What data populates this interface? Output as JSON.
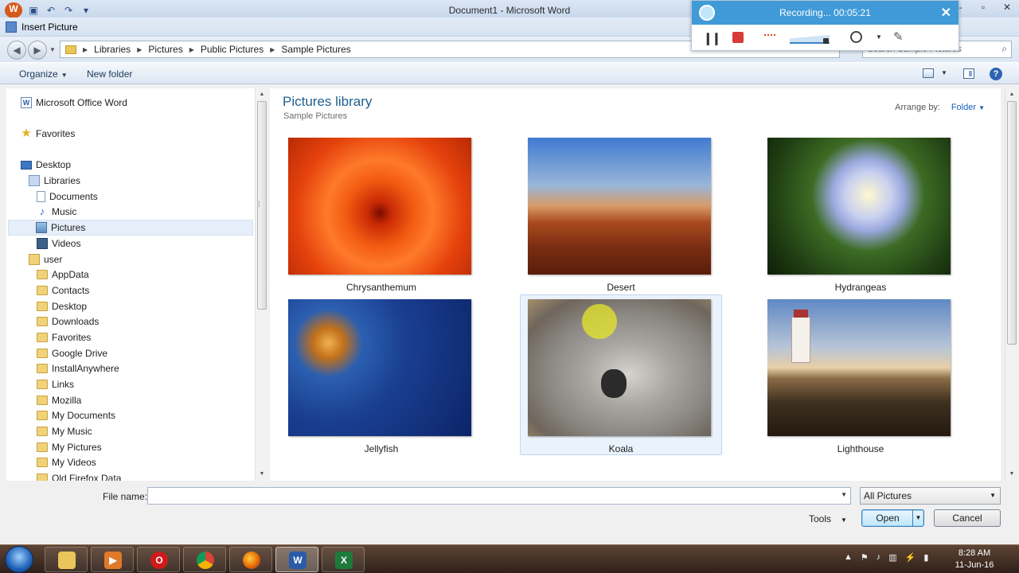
{
  "word_window": {
    "title": "Document1  -  Microsoft Word"
  },
  "dialog": {
    "title": "Insert Picture"
  },
  "address_bar": {
    "crumbs": [
      "Libraries",
      "Pictures",
      "Public Pictures",
      "Sample Pictures"
    ],
    "search_placeholder": "Search Sample Pictures"
  },
  "toolbar": {
    "organize_label": "Organize",
    "new_folder_label": "New folder"
  },
  "nav_pane": {
    "items": [
      {
        "label": "Microsoft Office Word",
        "icon": "word-icon"
      },
      {
        "label": "Favorites",
        "icon": "star-icon"
      },
      {
        "label": "Desktop",
        "icon": "desktop-icon"
      },
      {
        "label": "Libraries",
        "icon": "library-icon"
      },
      {
        "label": "Documents",
        "icon": "documents-icon"
      },
      {
        "label": "Music",
        "icon": "music-icon"
      },
      {
        "label": "Pictures",
        "icon": "pictures-icon",
        "selected": true
      },
      {
        "label": "Videos",
        "icon": "videos-icon"
      },
      {
        "label": "user",
        "icon": "user-folder-icon"
      },
      {
        "label": "AppData",
        "icon": "folder-icon"
      },
      {
        "label": "Contacts",
        "icon": "folder-icon"
      },
      {
        "label": "Desktop",
        "icon": "folder-icon"
      },
      {
        "label": "Downloads",
        "icon": "folder-icon"
      },
      {
        "label": "Favorites",
        "icon": "folder-icon"
      },
      {
        "label": "Google Drive",
        "icon": "folder-icon"
      },
      {
        "label": "InstallAnywhere",
        "icon": "folder-icon"
      },
      {
        "label": "Links",
        "icon": "folder-icon"
      },
      {
        "label": "Mozilla",
        "icon": "folder-icon"
      },
      {
        "label": "My Documents",
        "icon": "folder-icon"
      },
      {
        "label": "My Music",
        "icon": "folder-icon"
      },
      {
        "label": "My Pictures",
        "icon": "folder-icon"
      },
      {
        "label": "My Videos",
        "icon": "folder-icon"
      },
      {
        "label": "Old Firefox Data",
        "icon": "folder-icon"
      }
    ]
  },
  "content": {
    "library_title": "Pictures library",
    "library_subtitle": "Sample Pictures",
    "arrange_label": "Arrange by:",
    "arrange_value": "Folder",
    "thumbnails": [
      {
        "name": "Chrysanthemum"
      },
      {
        "name": "Desert"
      },
      {
        "name": "Hydrangeas"
      },
      {
        "name": "Jellyfish"
      },
      {
        "name": "Koala",
        "selected": true
      },
      {
        "name": "Lighthouse"
      }
    ]
  },
  "bottom_bar": {
    "file_name_label": "File name:",
    "file_name_value": "",
    "file_type_value": "All Pictures",
    "tools_label": "Tools",
    "open_label": "Open",
    "cancel_label": "Cancel"
  },
  "recorder": {
    "status": "Recording... 00:05:21"
  },
  "taskbar": {
    "time": "8:28 AM",
    "date": "11-Jun-16",
    "apps": [
      "explorer",
      "media-player",
      "opera",
      "chrome",
      "firefox",
      "word",
      "excel"
    ],
    "active_app": "word"
  }
}
